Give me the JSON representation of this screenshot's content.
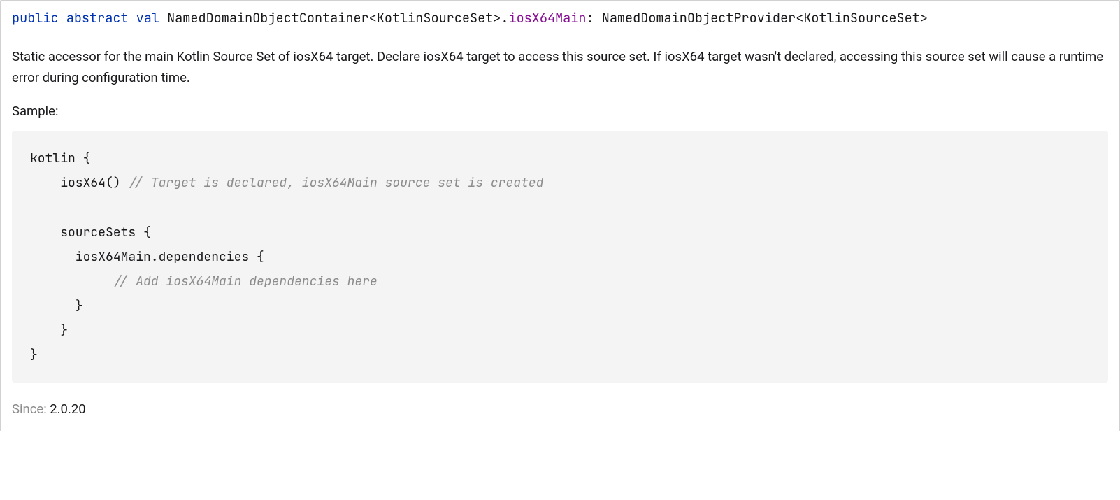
{
  "signature": {
    "kw_public": "public",
    "kw_abstract": "abstract",
    "kw_val": "val",
    "receiver": "NamedDomainObjectContainer<KotlinSourceSet>",
    "dot": ".",
    "member": "iosX64Main",
    "colon": ":",
    "return_type": "NamedDomainObjectProvider<KotlinSourceSet>"
  },
  "description": "Static accessor for the main Kotlin Source Set of iosX64 target. Declare iosX64 target to access this source set. If iosX64 target wasn't declared, accessing this source set will cause a runtime error during configuration time.",
  "sample_label": "Sample:",
  "code": {
    "l1": "kotlin {",
    "l2a": "    iosX64() ",
    "l2b": "// Target is declared, iosX64Main source set is created",
    "l3": "",
    "l4": "    sourceSets {",
    "l5": "      iosX64Main.dependencies {",
    "l6": "           // Add iosX64Main dependencies here",
    "l7": "      }",
    "l8": "    }",
    "l9": "}"
  },
  "since": {
    "label": "Since:",
    "value": "2.0.20"
  }
}
